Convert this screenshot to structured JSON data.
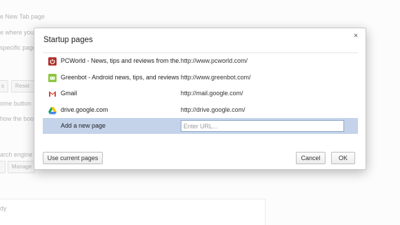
{
  "background": {
    "texts": [
      "e New Tab page",
      "e where you l",
      "specific page",
      "ome button",
      "how the boo",
      "arch engine",
      "dy"
    ],
    "buttons": [
      "s",
      "Reset",
      "Manage"
    ]
  },
  "dialog": {
    "title": "Startup pages",
    "close_label": "×",
    "pages": [
      {
        "title": "PCWorld - News, tips and reviews from the...",
        "url": "http://www.pcworld.com/",
        "icon": "pcworld-power-icon",
        "icon_color": "#b0302a"
      },
      {
        "title": "Greenbot - Android news, tips, and reviews",
        "url": "http://www.greenbot.com/",
        "icon": "greenbot-icon",
        "icon_color": "#8dc63f"
      },
      {
        "title": "Gmail",
        "url": "http://mail.google.com/",
        "icon": "gmail-icon",
        "icon_color": "#d44638"
      },
      {
        "title": "drive.google.com",
        "url": "http://drive.google.com/",
        "icon": "google-drive-icon",
        "icon_color": "#1da462"
      }
    ],
    "new_page": {
      "label": "Add a new page",
      "placeholder": "Enter URL..."
    },
    "buttons": {
      "use_current": "Use current pages",
      "cancel": "Cancel",
      "ok": "OK"
    }
  },
  "colors": {
    "selected_row": "#c4d3ea",
    "dialog_border": "#c9c9c9"
  }
}
